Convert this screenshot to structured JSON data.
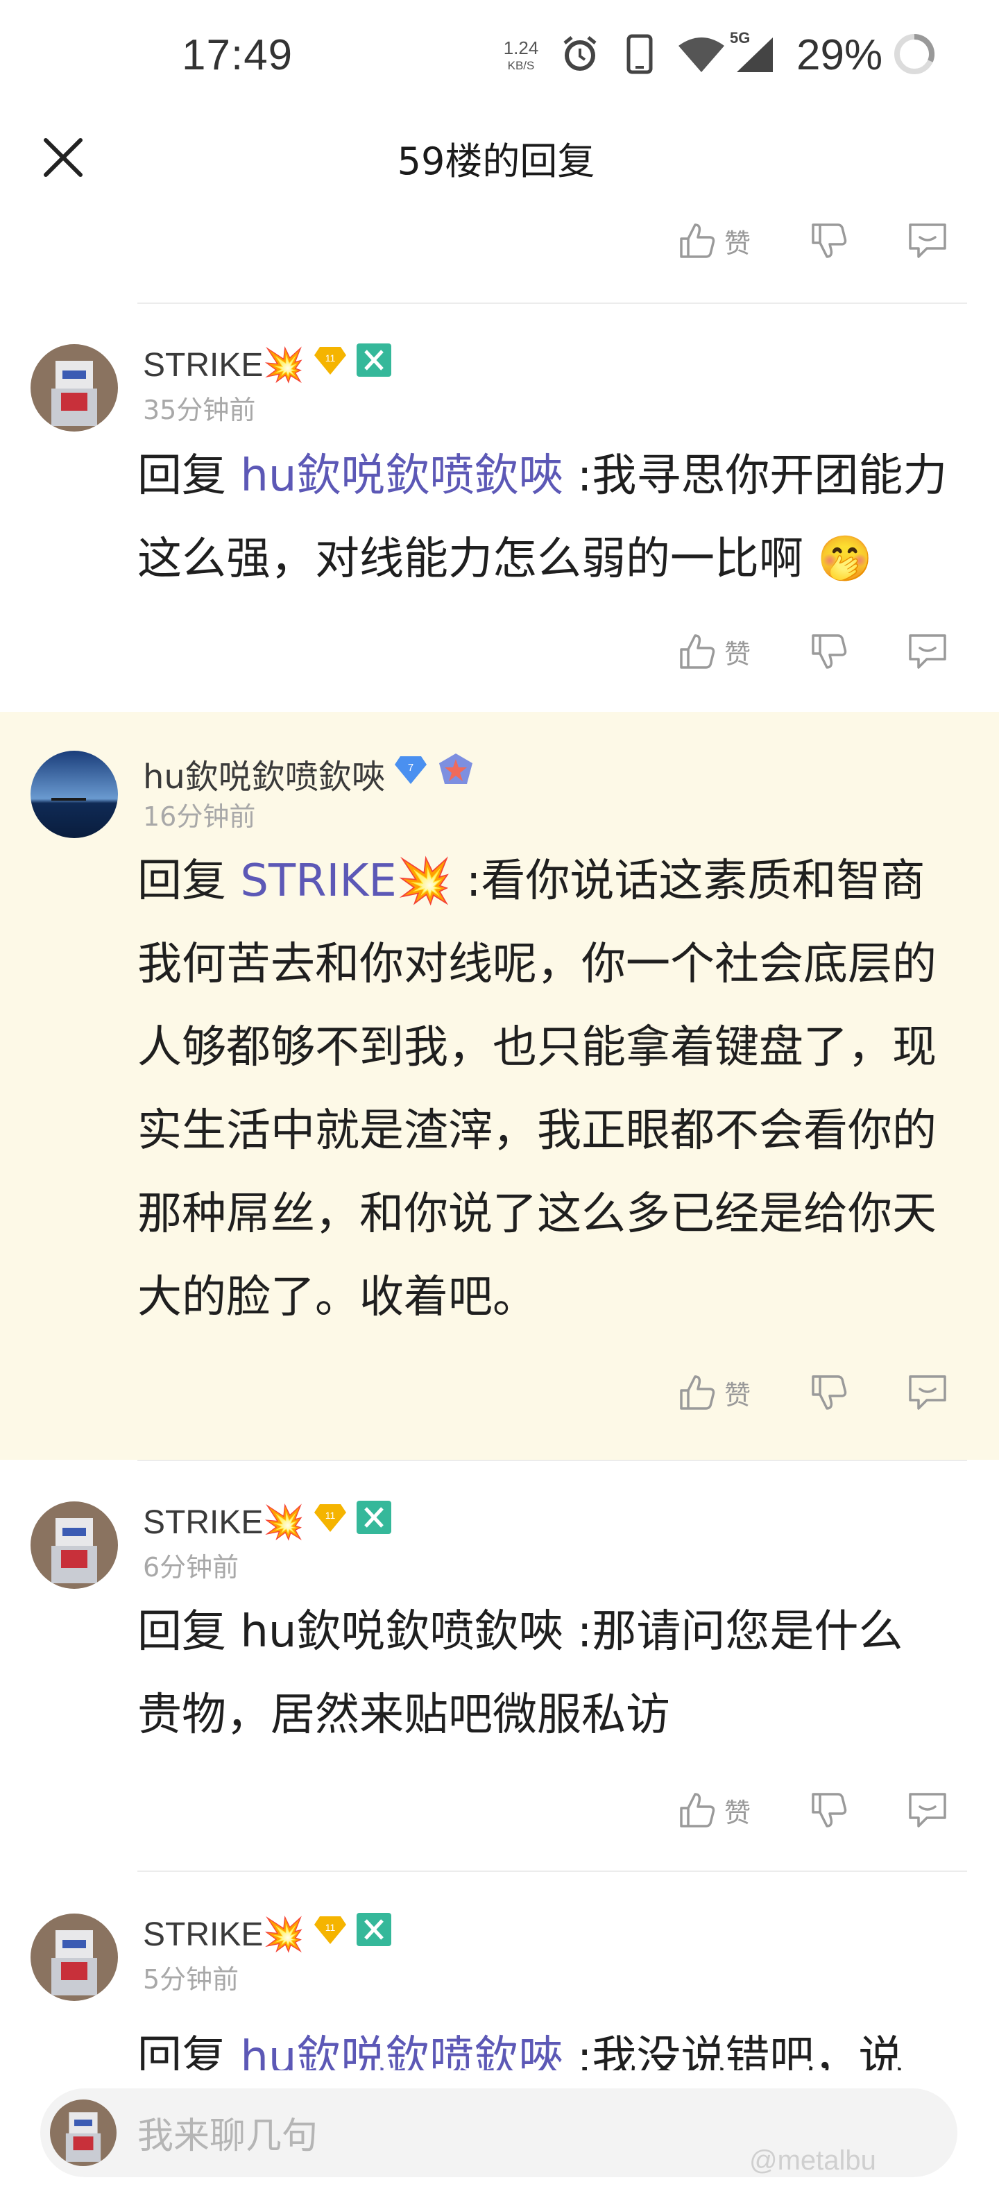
{
  "status_bar": {
    "time": "17:49",
    "net_speed_value": "1.24",
    "net_speed_unit": "KB/S",
    "network_label": "5G",
    "battery": "29%",
    "icons": [
      "alarm-icon",
      "phone-icon",
      "wifi-icon",
      "signal-icon",
      "battery-icon"
    ]
  },
  "header": {
    "title": "59楼的回复",
    "close_icon": "close-icon"
  },
  "actions": {
    "like_label": "赞"
  },
  "comments": [
    {
      "username": "STRIKE💥",
      "level": "11",
      "time": "35分钟前",
      "reply_prefix": "回复",
      "reply_target": "hu欽哾欽喷欽唊",
      "text": ":我寻思你开团能力这么强，对线能力怎么弱的一比啊",
      "emoji": "🤭"
    },
    {
      "username": "hu欽哾欽喷欽唊",
      "level": "7",
      "time": "16分钟前",
      "reply_prefix": "回复",
      "reply_target": "STRIKE💥",
      "text": ":看你说话这素质和智商我何苦去和你对线呢，你一个社会底层的人够都够不到我，也只能拿着键盘了，现实生活中就是渣滓，我正眼都不会看你的那种屌丝，和你说了这么多已经是给你天大的脸了。收着吧。"
    },
    {
      "username": "STRIKE💥",
      "level": "11",
      "time": "6分钟前",
      "reply_prefix": "回复",
      "reply_target": "hu欽哾欽喷欽唊",
      "text": ":那请问您是什么贵物，居然来贴吧微服私访"
    },
    {
      "username": "STRIKE💥",
      "level": "11",
      "time": "5分钟前",
      "reply_prefix": "回复",
      "reply_target": "hu欽哾欽喷欽唊",
      "text": ":我没说错吧，说"
    }
  ],
  "input": {
    "placeholder": "我来聊几句"
  },
  "watermark": "@metalbu",
  "colors": {
    "link": "#5c58b6",
    "highlight_bg": "#fdf9e7",
    "badge_gold": "#f5b400",
    "badge_blue": "#4a90f0",
    "badge_green": "#35b89a"
  }
}
